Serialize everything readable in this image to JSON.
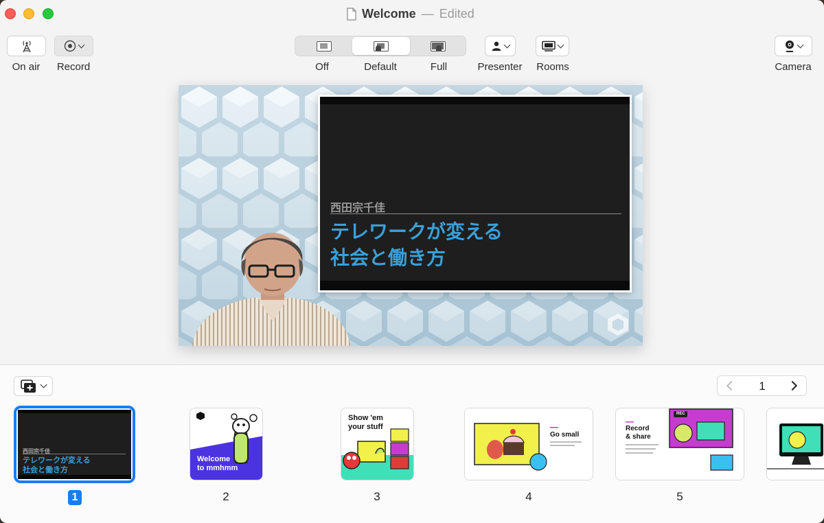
{
  "window": {
    "title": "Welcome",
    "separator": "—",
    "status": "Edited"
  },
  "toolbar": {
    "on_air_label": "On air",
    "record_label": "Record",
    "layout": {
      "options": [
        "Off",
        "Default",
        "Full"
      ],
      "selected": "Default"
    },
    "presenter_label": "Presenter",
    "rooms_label": "Rooms",
    "camera_label": "Camera"
  },
  "slide": {
    "author": "西田宗千佳",
    "title_line1": "テレワークが変える",
    "title_line2": "社会と働き方"
  },
  "tray": {
    "current_page": "1",
    "thumbnails": [
      {
        "number": "1",
        "author": "西田宗千佳",
        "title_line1": "テレワークが変える",
        "title_line2": "社会と働き方",
        "selected": true
      },
      {
        "number": "2",
        "title_line1": "Welcome",
        "title_line2": "to mmhmm"
      },
      {
        "number": "3",
        "title_line1": "Show 'em",
        "title_line2": "your stuff"
      },
      {
        "number": "4",
        "title_line1": "Go small"
      },
      {
        "number": "5",
        "title_line1": "Record",
        "title_line2": "& share",
        "badge": "REC"
      }
    ]
  },
  "colors": {
    "accent": "#1a7cf2",
    "slide_title": "#3aa0d8",
    "purple": "#4b33e0",
    "yellow": "#f2f04a",
    "mint": "#3fe0b8"
  }
}
